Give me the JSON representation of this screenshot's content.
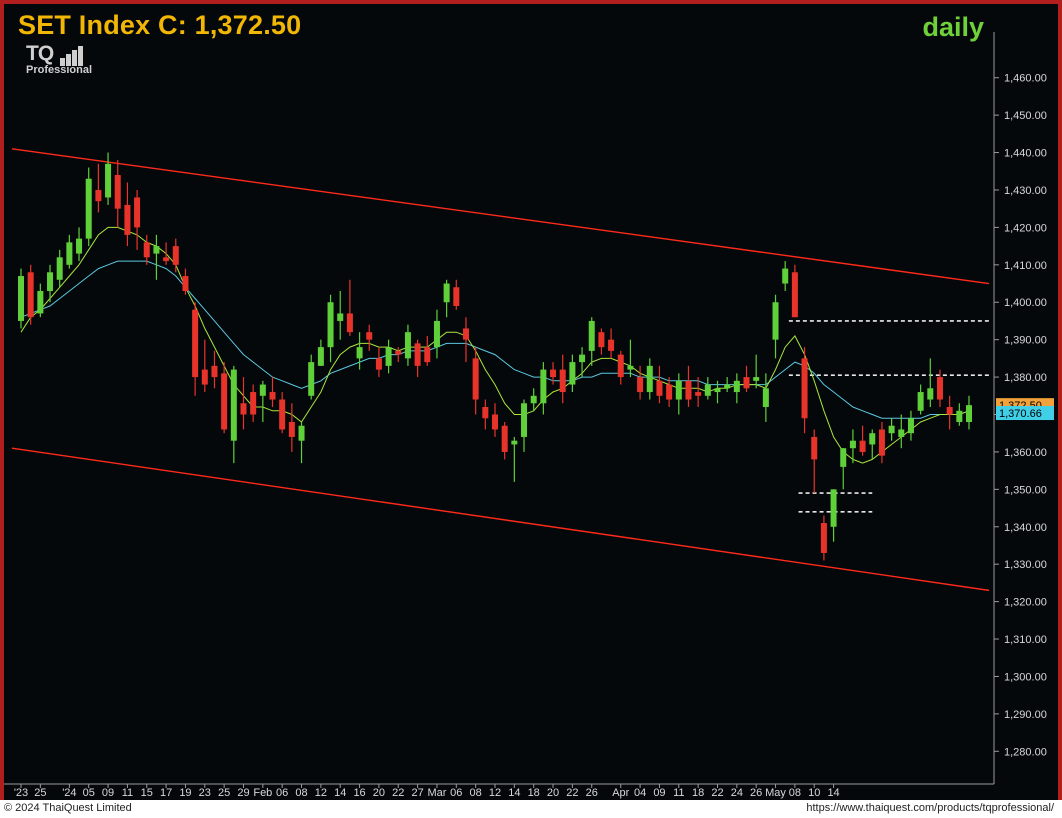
{
  "header": {
    "title": "SET Index C: 1,372.50",
    "period": "daily",
    "logo_mark": "TQ",
    "logo_sub": "Professional"
  },
  "footer": {
    "copyright": "© 2024 ThaiQuest Limited",
    "url": "https://www.thaiquest.com/products/tqprofessional/"
  },
  "colors": {
    "background": "#05080b",
    "up": "#5fd03a",
    "down": "#e8332a",
    "ma_fast": "#a8e63c",
    "ma_slow": "#5ac8e0",
    "channel": "#ff2a1a",
    "title": "#f2b705"
  },
  "chart_data": {
    "type": "candlestick",
    "title": "SET Index C: 1,372.50",
    "period": "daily",
    "ylim": [
      1275,
      1465
    ],
    "y_ticks": [
      "1,460.00",
      "1,450.00",
      "1,440.00",
      "1,430.00",
      "1,420.00",
      "1,410.00",
      "1,400.00",
      "1,390.00",
      "1,380.00",
      "1,370.00",
      "1,360.00",
      "1,350.00",
      "1,340.00",
      "1,330.00",
      "1,320.00",
      "1,310.00",
      "1,300.00",
      "1,290.00",
      "1,280.00"
    ],
    "x_labels": [
      {
        "i": 0,
        "t": "'23"
      },
      {
        "i": 2,
        "t": "25"
      },
      {
        "i": 5,
        "t": "'24"
      },
      {
        "i": 7,
        "t": "05"
      },
      {
        "i": 9,
        "t": "09"
      },
      {
        "i": 11,
        "t": "11"
      },
      {
        "i": 13,
        "t": "15"
      },
      {
        "i": 15,
        "t": "17"
      },
      {
        "i": 17,
        "t": "19"
      },
      {
        "i": 19,
        "t": "23"
      },
      {
        "i": 21,
        "t": "25"
      },
      {
        "i": 23,
        "t": "29"
      },
      {
        "i": 25,
        "t": "Feb"
      },
      {
        "i": 27,
        "t": "06"
      },
      {
        "i": 29,
        "t": "08"
      },
      {
        "i": 31,
        "t": "12"
      },
      {
        "i": 33,
        "t": "14"
      },
      {
        "i": 35,
        "t": "16"
      },
      {
        "i": 37,
        "t": "20"
      },
      {
        "i": 39,
        "t": "22"
      },
      {
        "i": 41,
        "t": "27"
      },
      {
        "i": 43,
        "t": "Mar"
      },
      {
        "i": 45,
        "t": "06"
      },
      {
        "i": 47,
        "t": "08"
      },
      {
        "i": 49,
        "t": "12"
      },
      {
        "i": 51,
        "t": "14"
      },
      {
        "i": 53,
        "t": "18"
      },
      {
        "i": 55,
        "t": "20"
      },
      {
        "i": 57,
        "t": "22"
      },
      {
        "i": 59,
        "t": "26"
      },
      {
        "i": 62,
        "t": "Apr"
      },
      {
        "i": 64,
        "t": "04"
      },
      {
        "i": 66,
        "t": "09"
      },
      {
        "i": 68,
        "t": "11"
      },
      {
        "i": 70,
        "t": "18"
      },
      {
        "i": 72,
        "t": "22"
      },
      {
        "i": 74,
        "t": "24"
      },
      {
        "i": 76,
        "t": "26"
      },
      {
        "i": 78,
        "t": "May"
      },
      {
        "i": 80,
        "t": "08"
      },
      {
        "i": 82,
        "t": "10"
      },
      {
        "i": 84,
        "t": "14"
      }
    ],
    "ohlc": [
      [
        1395,
        1409,
        1393,
        1407
      ],
      [
        1408,
        1410,
        1394,
        1396
      ],
      [
        1397,
        1405,
        1396,
        1403
      ],
      [
        1403,
        1410,
        1400,
        1408
      ],
      [
        1406,
        1414,
        1404,
        1412
      ],
      [
        1410,
        1418,
        1409,
        1416
      ],
      [
        1413,
        1420,
        1411,
        1417
      ],
      [
        1417,
        1436,
        1415,
        1433
      ],
      [
        1430,
        1437,
        1424,
        1427
      ],
      [
        1428,
        1440,
        1426,
        1437
      ],
      [
        1434,
        1438,
        1420,
        1425
      ],
      [
        1426,
        1432,
        1415,
        1418
      ],
      [
        1428,
        1430,
        1414,
        1420
      ],
      [
        1416,
        1418,
        1410,
        1412
      ],
      [
        1413,
        1418,
        1406,
        1415
      ],
      [
        1412,
        1416,
        1410,
        1411
      ],
      [
        1415,
        1417,
        1408,
        1410
      ],
      [
        1407,
        1409,
        1402,
        1403
      ],
      [
        1398,
        1400,
        1375,
        1380
      ],
      [
        1382,
        1390,
        1376,
        1378
      ],
      [
        1383,
        1387,
        1377,
        1380
      ],
      [
        1381,
        1384,
        1365,
        1366
      ],
      [
        1363,
        1383,
        1357,
        1382
      ],
      [
        1373,
        1380,
        1366,
        1370
      ],
      [
        1376,
        1378,
        1368,
        1370
      ],
      [
        1375,
        1379,
        1368,
        1378
      ],
      [
        1376,
        1380,
        1372,
        1374
      ],
      [
        1374,
        1376,
        1365,
        1366
      ],
      [
        1368,
        1373,
        1360,
        1364
      ],
      [
        1363,
        1368,
        1357,
        1367
      ],
      [
        1375,
        1386,
        1374,
        1384
      ],
      [
        1383,
        1390,
        1383,
        1388
      ],
      [
        1388,
        1402,
        1384,
        1400
      ],
      [
        1395,
        1403,
        1390,
        1397
      ],
      [
        1397,
        1406,
        1391,
        1392
      ],
      [
        1385,
        1392,
        1382,
        1388
      ],
      [
        1392,
        1394,
        1387,
        1390
      ],
      [
        1385,
        1388,
        1380,
        1382
      ],
      [
        1383,
        1390,
        1381,
        1388
      ],
      [
        1387,
        1388,
        1384,
        1386
      ],
      [
        1385,
        1394,
        1383,
        1392
      ],
      [
        1389,
        1390,
        1380,
        1383
      ],
      [
        1388,
        1391,
        1383,
        1384
      ],
      [
        1388,
        1398,
        1385,
        1395
      ],
      [
        1400,
        1406,
        1396,
        1405
      ],
      [
        1404,
        1406,
        1398,
        1399
      ],
      [
        1393,
        1396,
        1384,
        1390
      ],
      [
        1385,
        1388,
        1370,
        1374
      ],
      [
        1372,
        1374,
        1366,
        1369
      ],
      [
        1370,
        1373,
        1364,
        1366
      ],
      [
        1367,
        1368,
        1358,
        1360
      ],
      [
        1362,
        1364,
        1352,
        1363
      ],
      [
        1364,
        1374,
        1360,
        1373
      ],
      [
        1373,
        1377,
        1371,
        1375
      ],
      [
        1373,
        1384,
        1370,
        1382
      ],
      [
        1382,
        1384,
        1378,
        1380
      ],
      [
        1382,
        1386,
        1373,
        1376
      ],
      [
        1378,
        1386,
        1376,
        1384
      ],
      [
        1384,
        1388,
        1380,
        1386
      ],
      [
        1387,
        1396,
        1383,
        1395
      ],
      [
        1392,
        1393,
        1386,
        1388
      ],
      [
        1390,
        1393,
        1385,
        1387
      ],
      [
        1386,
        1387,
        1378,
        1380
      ],
      [
        1382,
        1390,
        1380,
        1383
      ],
      [
        1380,
        1383,
        1374,
        1376
      ],
      [
        1376,
        1385,
        1374,
        1383
      ],
      [
        1379,
        1383,
        1373,
        1375
      ],
      [
        1378,
        1380,
        1372,
        1374
      ],
      [
        1374,
        1381,
        1370,
        1379
      ],
      [
        1379,
        1383,
        1372,
        1374
      ],
      [
        1376,
        1380,
        1372,
        1375
      ],
      [
        1375,
        1380,
        1374,
        1378
      ],
      [
        1376,
        1379,
        1373,
        1377
      ],
      [
        1377,
        1380,
        1376,
        1378
      ],
      [
        1376,
        1381,
        1373,
        1379
      ],
      [
        1380,
        1383,
        1376,
        1377
      ],
      [
        1379,
        1386,
        1377,
        1380
      ],
      [
        1372,
        1381,
        1368,
        1377
      ],
      [
        1390,
        1402,
        1385,
        1400
      ],
      [
        1405,
        1411,
        1403,
        1409
      ],
      [
        1408,
        1410,
        1396,
        1396
      ],
      [
        1385,
        1388,
        1365,
        1369
      ],
      [
        1364,
        1366,
        1349,
        1358
      ],
      [
        1341,
        1343,
        1331,
        1333
      ],
      [
        1340,
        1350,
        1336,
        1350
      ],
      [
        1356,
        1361,
        1350,
        1361
      ],
      [
        1361,
        1366,
        1357,
        1363
      ],
      [
        1363,
        1367,
        1359,
        1360
      ],
      [
        1362,
        1366,
        1358,
        1365
      ],
      [
        1366,
        1368,
        1357,
        1359
      ],
      [
        1365,
        1369,
        1363,
        1367
      ],
      [
        1364,
        1370,
        1361,
        1366
      ],
      [
        1365,
        1371,
        1363,
        1369
      ],
      [
        1371,
        1378,
        1370,
        1376
      ],
      [
        1374,
        1385,
        1372,
        1377
      ],
      [
        1380,
        1382,
        1372,
        1374
      ],
      [
        1372,
        1375,
        1366,
        1370
      ],
      [
        1368,
        1373,
        1367,
        1371
      ],
      [
        1368,
        1375,
        1366,
        1372.5
      ]
    ],
    "ma_fast": [
      1392,
      1396,
      1398,
      1401,
      1404,
      1407,
      1410,
      1414,
      1418,
      1420,
      1420,
      1419,
      1418,
      1416,
      1415,
      1413,
      1410,
      1404,
      1399,
      1393,
      1388,
      1383,
      1378,
      1375,
      1372,
      1372,
      1371,
      1371,
      1370,
      1368,
      1372,
      1376,
      1382,
      1386,
      1388,
      1389,
      1389,
      1388,
      1388,
      1387,
      1388,
      1388,
      1388,
      1390,
      1392,
      1392,
      1391,
      1387,
      1382,
      1378,
      1373,
      1370,
      1370,
      1371,
      1374,
      1376,
      1377,
      1379,
      1381,
      1384,
      1385,
      1385,
      1384,
      1383,
      1381,
      1380,
      1379,
      1378,
      1377,
      1377,
      1377,
      1376,
      1377,
      1377,
      1378,
      1378,
      1378,
      1377,
      1382,
      1388,
      1391,
      1386,
      1379,
      1371,
      1364,
      1360,
      1358,
      1357,
      1358,
      1360,
      1362,
      1364,
      1366,
      1368,
      1369,
      1370,
      1370,
      1370,
      1371
    ],
    "ma_slow": [
      1396,
      1397,
      1398,
      1399,
      1401,
      1403,
      1405,
      1407,
      1409,
      1410,
      1411,
      1411,
      1411,
      1411,
      1410,
      1409,
      1407,
      1404,
      1401,
      1398,
      1395,
      1392,
      1389,
      1386,
      1384,
      1382,
      1380,
      1379,
      1378,
      1377,
      1378,
      1379,
      1381,
      1382,
      1383,
      1384,
      1385,
      1385,
      1386,
      1386,
      1387,
      1387,
      1387,
      1388,
      1389,
      1389,
      1389,
      1388,
      1387,
      1386,
      1384,
      1382,
      1381,
      1380,
      1380,
      1379,
      1379,
      1379,
      1380,
      1380,
      1381,
      1381,
      1381,
      1381,
      1380,
      1380,
      1380,
      1379,
      1379,
      1379,
      1379,
      1378,
      1378,
      1378,
      1378,
      1378,
      1378,
      1378,
      1380,
      1382,
      1384,
      1383,
      1381,
      1378,
      1376,
      1374,
      1372,
      1371,
      1370,
      1369,
      1369,
      1369,
      1369,
      1369,
      1370,
      1370,
      1370,
      1370,
      1371
    ],
    "channel_upper": {
      "start": 1441,
      "end": 1405
    },
    "channel_lower": {
      "start": 1361,
      "end": 1323
    },
    "support_lines": [
      {
        "value": 1395,
        "from_i": 80,
        "to_i": 98
      },
      {
        "value": 1380.5,
        "from_i": 80,
        "to_i": 98
      },
      {
        "value": 1349,
        "from_i": 81,
        "to_i": 88
      },
      {
        "value": 1344,
        "from_i": 81,
        "to_i": 88
      }
    ],
    "last_price": "1,372.50",
    "ma_value": "1,370.66"
  }
}
